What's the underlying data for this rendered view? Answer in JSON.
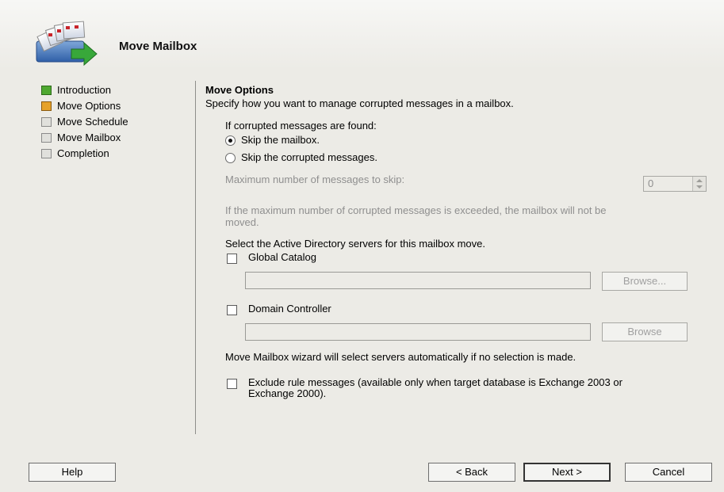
{
  "wizard": {
    "title": "Move Mailbox"
  },
  "nav": {
    "items": [
      {
        "label": "Introduction",
        "state": "done"
      },
      {
        "label": "Move Options",
        "state": "current"
      },
      {
        "label": "Move Schedule",
        "state": "pending"
      },
      {
        "label": "Move Mailbox",
        "state": "pending"
      },
      {
        "label": "Completion",
        "state": "pending"
      }
    ]
  },
  "options": {
    "section_title": "Move Options",
    "description": "Specify how you want to manage corrupted messages in a mailbox.",
    "corrupted_prompt": "If corrupted messages are found:",
    "radio_skip_mailbox": "Skip the mailbox.",
    "radio_skip_messages": "Skip the corrupted messages.",
    "selected": "skip_mailbox",
    "max_label": "Maximum number of messages to skip:",
    "max_value": "0",
    "max_note_line1": "If the maximum number of corrupted messages is exceeded, the mailbox will not be",
    "max_note_line2": "moved.",
    "ad_prompt": "Select the Active Directory servers for this mailbox move.",
    "global_catalog_label": "Global Catalog",
    "global_catalog_value": "",
    "browse1_label": "Browse...",
    "domain_controller_label": "Domain Controller",
    "domain_controller_value": "",
    "browse2_label": "Browse",
    "auto_note": "Move Mailbox wizard will select servers automatically if no selection is made.",
    "exclude_line1": "Exclude rule messages (available only when target database is Exchange 2003 or",
    "exclude_line2": "Exchange 2000)."
  },
  "footer": {
    "help_label": "Help",
    "back_label": "< Back",
    "next_label": "Next >",
    "cancel_label": "Cancel"
  },
  "colors": {
    "step_done": "#4ea830",
    "step_current": "#e6a22a",
    "background": "#ecebe6"
  }
}
